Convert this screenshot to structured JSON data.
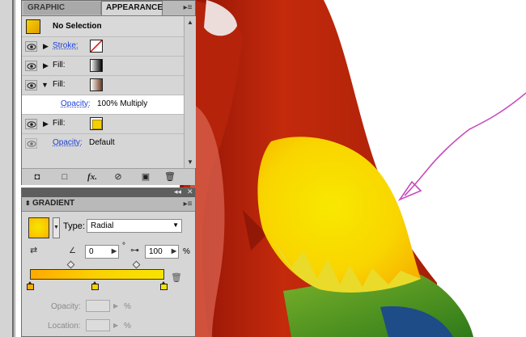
{
  "appearance_panel": {
    "tabs": [
      "GRAPHIC STYLES",
      "APPEARANCE"
    ],
    "header_title": "No Selection",
    "rows": [
      {
        "label": "Stroke:"
      },
      {
        "label": "Fill:"
      },
      {
        "label": "Fill:"
      },
      {
        "label": "Opacity:",
        "value": "100% Multiply"
      },
      {
        "label": "Fill:"
      },
      {
        "label": "Opacity:",
        "value": "Default"
      }
    ]
  },
  "gradient_panel": {
    "tab": "GRADIENT",
    "type_label": "Type:",
    "type_value": "Radial",
    "angle_value": "0",
    "degree_symbol": "°",
    "aspect_value": "100",
    "percent_symbol": "%",
    "opacity_label": "Opacity:",
    "location_label": "Location:",
    "stops": [
      "#ffaa00",
      "#fbd200",
      "#f8e400"
    ]
  },
  "colors": {
    "link": "#1d3ed6",
    "arrow_annotation": "#c94bbd"
  }
}
